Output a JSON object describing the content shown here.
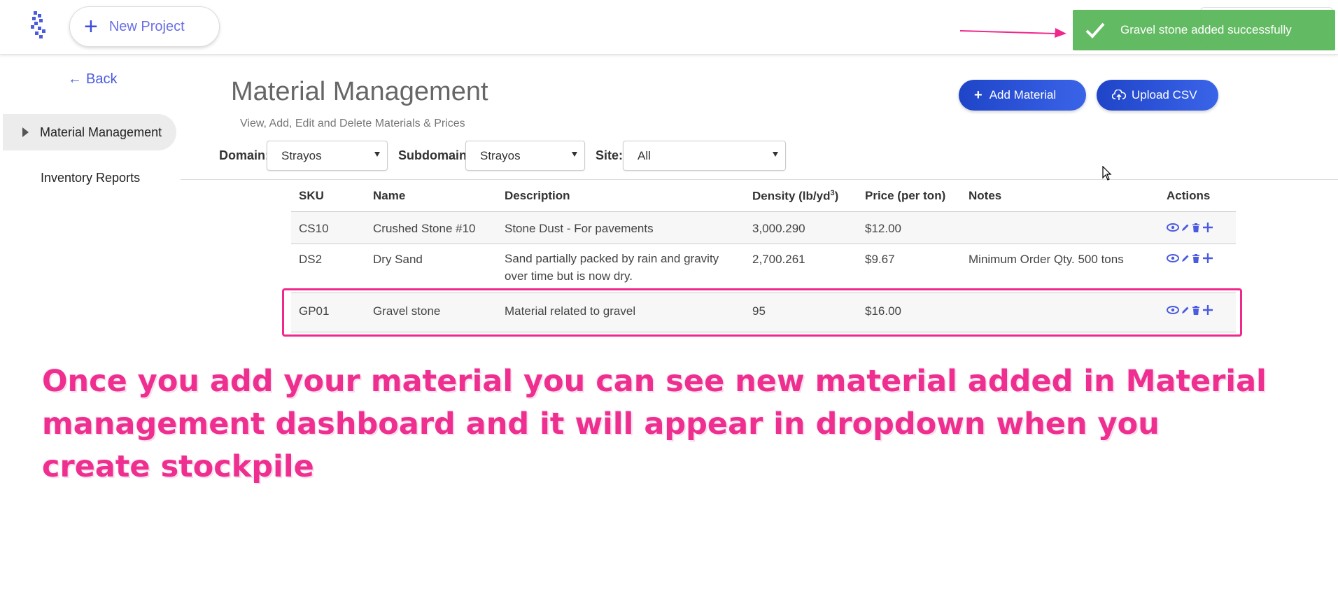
{
  "topbar": {
    "new_project_label": "New Project"
  },
  "toast": {
    "message": "Gravel stone added successfully",
    "color": "#5cb85c"
  },
  "sidebar": {
    "back_label": "Back",
    "items": [
      {
        "label": "Material Management",
        "active": true
      },
      {
        "label": "Inventory Reports",
        "active": false
      }
    ]
  },
  "header": {
    "title": "Material Management",
    "subtitle": "View, Add, Edit and Delete Materials & Prices",
    "add_button": "Add Material",
    "upload_button": "Upload CSV"
  },
  "filters": {
    "domain_label": "Domain:",
    "domain_value": "Strayos",
    "subdomain_label": "Subdomain:",
    "subdomain_value": "Strayos",
    "site_label": "Site:",
    "site_value": "All"
  },
  "table": {
    "headers": {
      "sku": "SKU",
      "name": "Name",
      "description": "Description",
      "density": "Density (lb/yd",
      "density_sup": "3",
      "density_close": ")",
      "price": "Price (per ton)",
      "notes": "Notes",
      "actions": "Actions"
    },
    "rows": [
      {
        "sku": "CS10",
        "name": "Crushed Stone #10",
        "description": "Stone Dust - For pavements",
        "density": "3,000.290",
        "price": "$12.00",
        "notes": ""
      },
      {
        "sku": "DS2",
        "name": "Dry Sand",
        "description": "Sand partially packed by rain and gravity over time but is now dry.",
        "density": "2,700.261",
        "price": "$9.67",
        "notes": "Minimum Order Qty. 500 tons"
      },
      {
        "sku": "GP01",
        "name": "Gravel stone",
        "description": "Material related to gravel",
        "density": "95",
        "price": "$16.00",
        "notes": ""
      }
    ]
  },
  "caption": {
    "text": "Once you add your material you can see new material added in Material management dashboard and it will appear in dropdown when you create stockpile"
  },
  "colors": {
    "accent_blue": "#3a64e8",
    "highlight_pink": "#f0288c"
  },
  "icons": [
    "logo-icon",
    "plus-icon",
    "check-icon",
    "arrow-left-icon",
    "caret-right-icon",
    "cloud-upload-icon",
    "eye-icon",
    "pencil-icon",
    "trash-icon",
    "plus-icon",
    "cursor-icon"
  ]
}
